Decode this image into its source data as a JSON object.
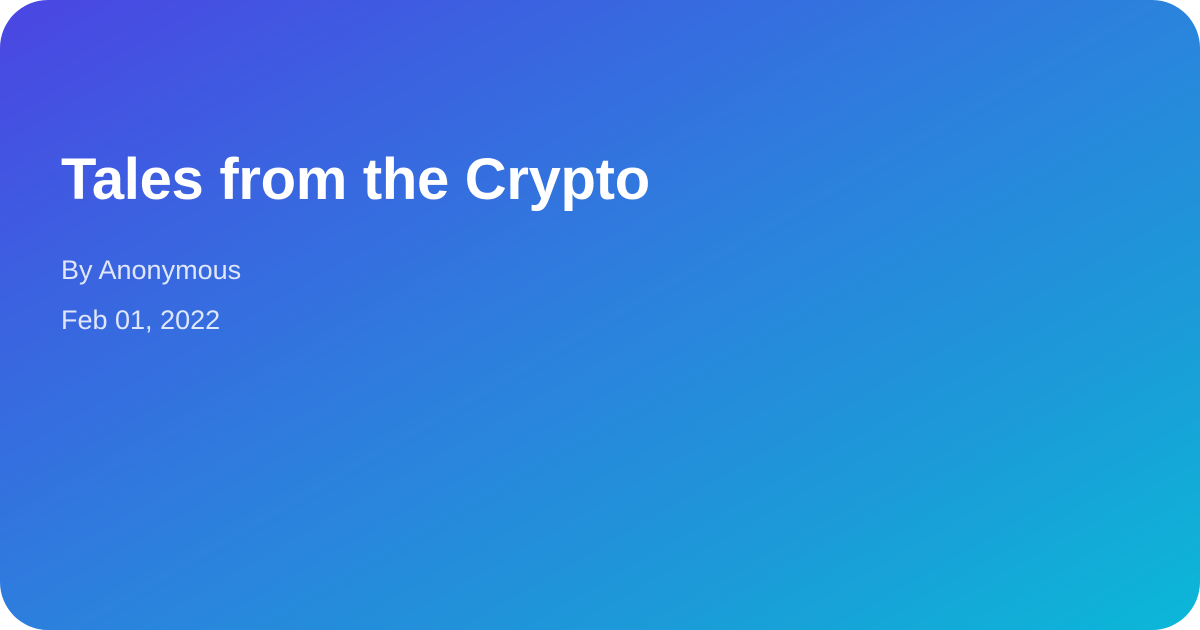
{
  "card": {
    "title": "Tales from the Crypto",
    "author": "By Anonymous",
    "date": "Feb 01, 2022",
    "gradient_colors": [
      "#4b45e3",
      "#0bb8d8"
    ],
    "text_color": "#ffffff"
  }
}
